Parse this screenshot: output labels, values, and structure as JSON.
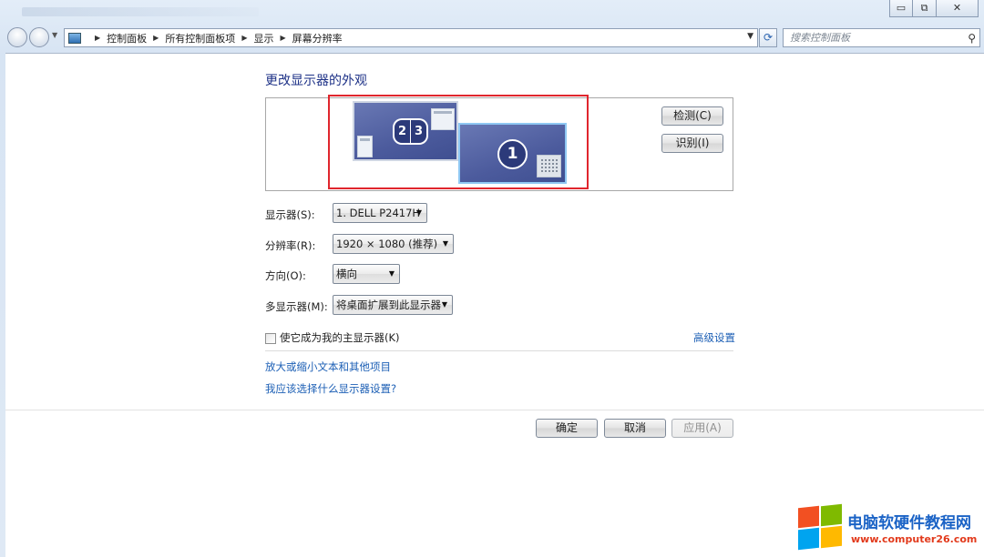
{
  "window": {
    "controls": {
      "minimize": "▭",
      "maximize": "⧉",
      "close": "✕"
    }
  },
  "address_bar": {
    "breadcrumbs": [
      "控制面板",
      "所有控制面板项",
      "显示",
      "屏幕分辨率"
    ],
    "search_placeholder": "搜索控制面板"
  },
  "page": {
    "title": "更改显示器的外观",
    "preview": {
      "monitors": [
        {
          "id": "monitor-2-3",
          "digits": [
            "2",
            "3"
          ]
        },
        {
          "id": "monitor-1",
          "digits": [
            "1"
          ],
          "selected": true
        }
      ],
      "highlight_color": "#e0262d"
    },
    "detect_button": "检测(C)",
    "identify_button": "识别(I)",
    "settings": [
      {
        "label": "显示器(S):",
        "value": "1. DELL P2417H"
      },
      {
        "label": "分辨率(R):",
        "value": "1920 × 1080 (推荐)"
      },
      {
        "label": "方向(O):",
        "value": "横向"
      },
      {
        "label": "多显示器(M):",
        "value": "将桌面扩展到此显示器"
      }
    ],
    "primary_checkbox": {
      "label": "使它成为我的主显示器(K)",
      "checked": false
    },
    "advanced_link": "高级设置",
    "links": [
      "放大或缩小文本和其他项目",
      "我应该选择什么显示器设置?"
    ],
    "buttons": {
      "ok": "确定",
      "cancel": "取消",
      "apply": "应用(A)"
    }
  },
  "watermark": {
    "title": "电脑软硬件教程网",
    "url": "www.computer26.com"
  },
  "colors": {
    "link": "#1c5fb5",
    "title": "#1e3287",
    "monitor_fill": "#4c5b9d"
  }
}
